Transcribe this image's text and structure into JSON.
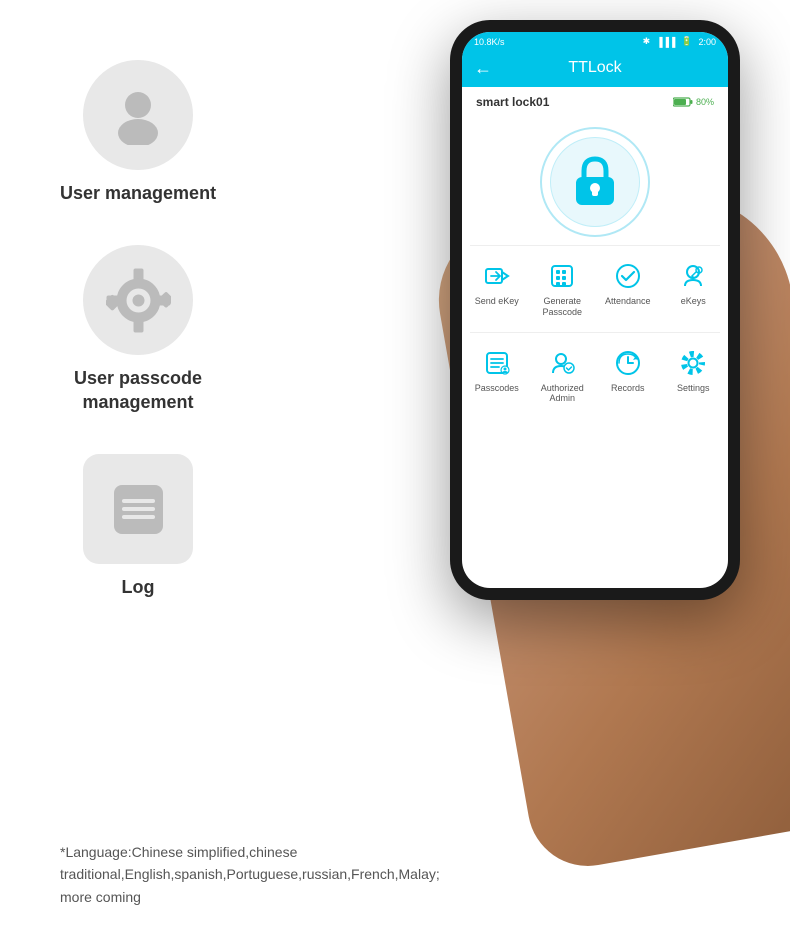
{
  "features": [
    {
      "id": "user-management",
      "label": "User\nmanagement",
      "icon_type": "circle",
      "icon_name": "person-icon"
    },
    {
      "id": "passcode-management",
      "label": "User passcode\nmanagement",
      "icon_type": "gear",
      "icon_name": "gear-icon"
    },
    {
      "id": "log",
      "label": "Log",
      "icon_type": "square",
      "icon_name": "log-icon"
    }
  ],
  "phone": {
    "status_bar": {
      "signal": "10.8K/s",
      "bluetooth": "⁎",
      "battery_icon": "▮",
      "time": "2:00"
    },
    "header": {
      "back_icon": "←",
      "title": "TTLock"
    },
    "lock_name": "smart lock01",
    "battery_percent": "80%",
    "grid_row1": [
      {
        "label": "Send eKey",
        "icon": "send"
      },
      {
        "label": "Generate\nPasscode",
        "icon": "keypad"
      },
      {
        "label": "Attendance",
        "icon": "check-circle"
      },
      {
        "label": "eKeys",
        "icon": "person-key"
      }
    ],
    "grid_row2": [
      {
        "label": "Passcodes",
        "icon": "list"
      },
      {
        "label": "Authorized\nAdmin",
        "icon": "person-admin"
      },
      {
        "label": "Records",
        "icon": "clock-history"
      },
      {
        "label": "Settings",
        "icon": "settings"
      }
    ]
  },
  "bottom_text": "*Language:Chinese simplified,chinese traditional,English,spanish,Portuguese,russian,French,Malay; more coming"
}
